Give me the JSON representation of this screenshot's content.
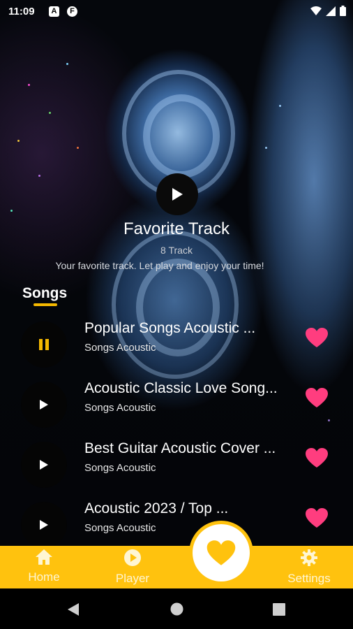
{
  "status_bar": {
    "time": "11:09",
    "icons": [
      "a-notification-icon",
      "f-notification-icon",
      "wifi-icon",
      "signal-icon",
      "battery-icon"
    ]
  },
  "header": {
    "title": "Favorite Track",
    "count": "8 Track",
    "description": "Your favorite track. Let play and enjoy your time!"
  },
  "songs_section": {
    "heading": "Songs"
  },
  "songs": [
    {
      "title": "Popular Songs Acoustic ...",
      "subtitle": "Songs Acoustic",
      "state": "playing",
      "favorite": true
    },
    {
      "title": "Acoustic Classic Love Song...",
      "subtitle": "Songs Acoustic",
      "state": "paused",
      "favorite": true
    },
    {
      "title": "Best Guitar Acoustic Cover ...",
      "subtitle": "Songs Acoustic",
      "state": "paused",
      "favorite": true
    },
    {
      "title": "Acoustic 2023 / Top ...",
      "subtitle": "Songs Acoustic",
      "state": "paused",
      "favorite": true
    }
  ],
  "bottom_nav": {
    "home": "Home",
    "player": "Player",
    "settings": "Settings",
    "active": "favorites"
  },
  "colors": {
    "accent": "#ffc20e",
    "heart": "#ff3d7f",
    "play_accent": "#f5b800"
  }
}
